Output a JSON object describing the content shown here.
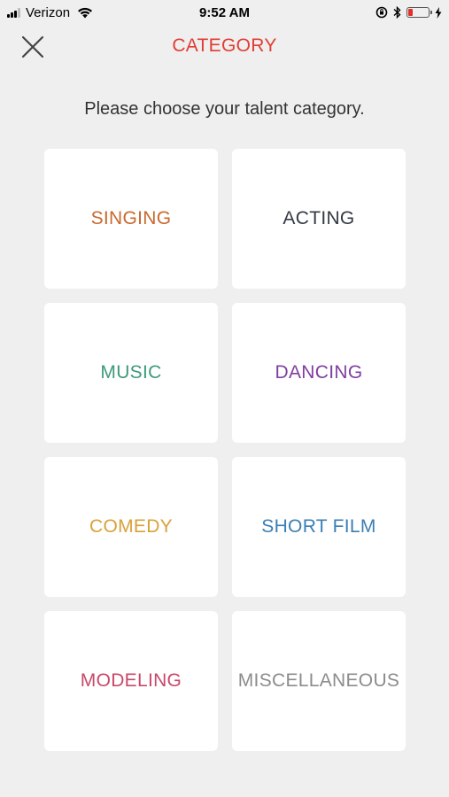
{
  "status_bar": {
    "carrier": "Verizon",
    "time": "9:52 AM"
  },
  "header": {
    "title": "CATEGORY"
  },
  "prompt": "Please choose your talent category.",
  "categories": [
    {
      "label": "SINGING",
      "color": "#c8692e"
    },
    {
      "label": "ACTING",
      "color": "#333a44"
    },
    {
      "label": "MUSIC",
      "color": "#3d9b78"
    },
    {
      "label": "DANCING",
      "color": "#7f3fa0"
    },
    {
      "label": "COMEDY",
      "color": "#d8a23a"
    },
    {
      "label": "SHORT FILM",
      "color": "#3a7fb5"
    },
    {
      "label": "MODELING",
      "color": "#c9486b"
    },
    {
      "label": "MISCELLANEOUS",
      "color": "#8c8c8c"
    }
  ],
  "colors": {
    "title": "#e13d33",
    "background": "#efefef",
    "tile": "#ffffff"
  }
}
